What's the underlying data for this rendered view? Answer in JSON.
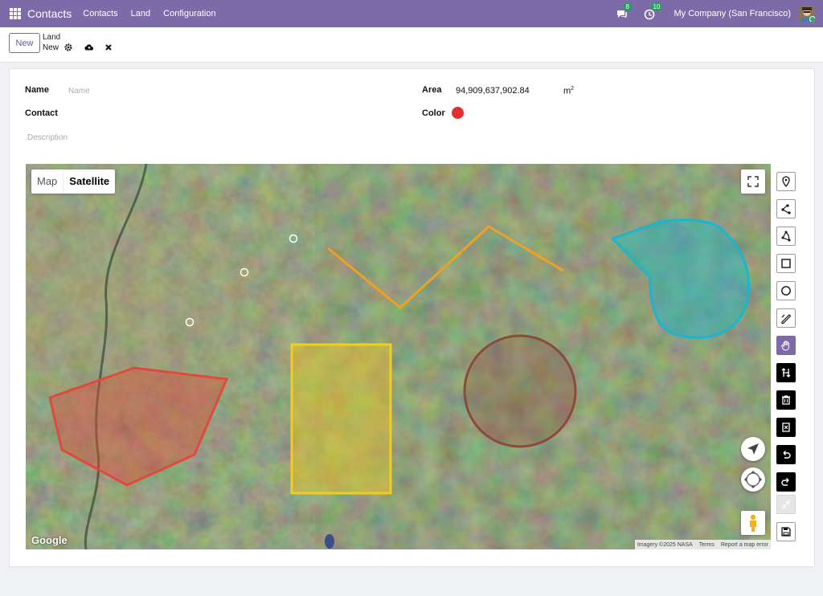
{
  "navbar": {
    "app_title": "Contacts",
    "menu": [
      "Contacts",
      "Land",
      "Configuration"
    ],
    "messages_count": "8",
    "activities_count": "10",
    "company": "My Company (San Francisco)"
  },
  "control_panel": {
    "new_button": "New",
    "breadcrumb_parent": "Land",
    "breadcrumb_current": "New"
  },
  "form": {
    "name_label": "Name",
    "name_placeholder": "Name",
    "name_value": "",
    "contact_label": "Contact",
    "description_placeholder": "Description",
    "area_label": "Area",
    "area_value": "94,909,637,902.84",
    "area_unit": "m",
    "area_unit_exp": "2",
    "color_label": "Color",
    "color_value": "#e72e2e"
  },
  "map": {
    "type_map": "Map",
    "type_satellite": "Satellite",
    "selected_type": "Satellite",
    "google_logo": "Google",
    "attribution": [
      "Imagery ©2025 NASA",
      "Terms",
      "Report a map error"
    ],
    "shape_colors": {
      "polygon": "#e04a3c",
      "polyline": "#f0a022",
      "rectangle": "#f2cd21",
      "circle": "#8c4a3c",
      "cyan_shape": "#1ab5cf"
    }
  },
  "toolbar": {
    "icons": [
      "marker-icon",
      "polyline-icon",
      "polygon-icon",
      "rectangle-icon",
      "circle-icon",
      "freehand-icon",
      "hand-icon",
      "reorder-icon",
      "delete-icon",
      "clear-icon",
      "undo-icon",
      "redo-icon",
      "collapse-icon",
      "save-icon"
    ],
    "active_tool": "hand-icon"
  }
}
